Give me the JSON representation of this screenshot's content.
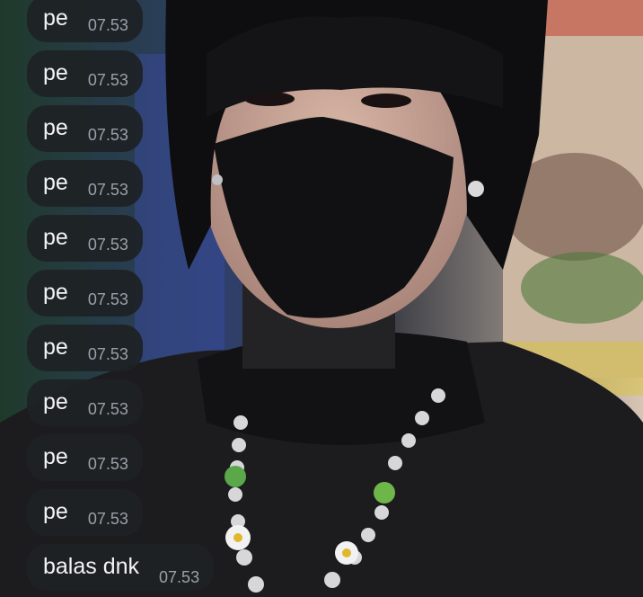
{
  "wallpaper": {
    "description_icon": "person-photo-icon",
    "colors": {
      "hair": "#0d0d0f",
      "mask": "#121214",
      "skin": "#c9a797",
      "jacket": "#1b1b1e",
      "bg_left": "#233a2e",
      "bg_right": "#d7c9b8"
    }
  },
  "messages": [
    {
      "text": "pe",
      "time": "07.53"
    },
    {
      "text": "pe",
      "time": "07.53"
    },
    {
      "text": "pe",
      "time": "07.53"
    },
    {
      "text": "pe",
      "time": "07.53"
    },
    {
      "text": "pe",
      "time": "07.53"
    },
    {
      "text": "pe",
      "time": "07.53"
    },
    {
      "text": "pe",
      "time": "07.53"
    },
    {
      "text": "pe",
      "time": "07.53"
    },
    {
      "text": "pe",
      "time": "07.53"
    },
    {
      "text": "pe",
      "time": "07.53"
    },
    {
      "text": "balas dnk",
      "time": "07.53"
    }
  ]
}
